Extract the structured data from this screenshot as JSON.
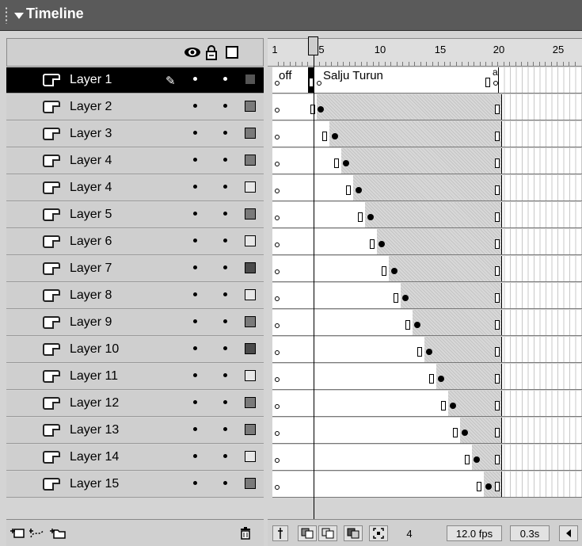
{
  "panel": {
    "title": "Timeline"
  },
  "ruler": {
    "labels": [
      "1",
      "5",
      "10",
      "15",
      "20",
      "25"
    ]
  },
  "labels": {
    "off": "off",
    "scene": "Salju Turun",
    "action_marker": "a"
  },
  "layers": [
    {
      "name": "Layer 1",
      "active": true,
      "outline": "fill"
    },
    {
      "name": "Layer 2",
      "active": false,
      "outline": "fill"
    },
    {
      "name": "Layer 3",
      "active": false,
      "outline": "fill"
    },
    {
      "name": "Layer 4",
      "active": false,
      "outline": "fill"
    },
    {
      "name": "Layer 4",
      "active": false,
      "outline": "empty"
    },
    {
      "name": "Layer 5",
      "active": false,
      "outline": "fill"
    },
    {
      "name": "Layer 6",
      "active": false,
      "outline": "empty"
    },
    {
      "name": "Layer 7",
      "active": false,
      "outline": "dark"
    },
    {
      "name": "Layer 8",
      "active": false,
      "outline": "empty"
    },
    {
      "name": "Layer 9",
      "active": false,
      "outline": "fill"
    },
    {
      "name": "Layer 10",
      "active": false,
      "outline": "dark"
    },
    {
      "name": "Layer 11",
      "active": false,
      "outline": "empty"
    },
    {
      "name": "Layer 12",
      "active": false,
      "outline": "fill"
    },
    {
      "name": "Layer 13",
      "active": false,
      "outline": "fill"
    },
    {
      "name": "Layer 14",
      "active": false,
      "outline": "empty"
    },
    {
      "name": "Layer 15",
      "active": false,
      "outline": "fill"
    }
  ],
  "status": {
    "current_frame": "4",
    "frame_rate": "12.0 fps",
    "elapsed": "0.3s"
  },
  "colors": {
    "titlebar": "#5a5a5a",
    "panel": "#d4d4d4",
    "active_row": "#000000",
    "tween": "#d8d8d8"
  },
  "icons": [
    "eye-icon",
    "lock-icon",
    "outline-icon",
    "pencil-icon",
    "insert-layer-icon",
    "motion-guide-icon",
    "insert-folder-icon",
    "trash-icon",
    "center-frame-icon",
    "onion-skin-icon",
    "onion-outline-icon",
    "edit-multiple-icon",
    "onion-markers-icon",
    "scroll-left-icon"
  ]
}
